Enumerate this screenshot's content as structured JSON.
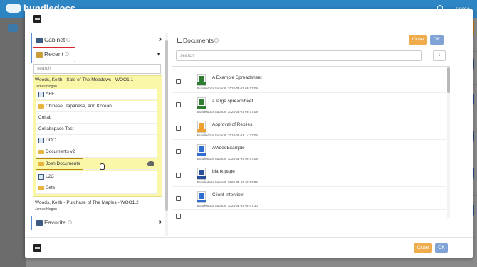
{
  "background": {
    "brand": "bundledocs",
    "user": "demo"
  },
  "modal": {
    "left": {
      "cabinet": {
        "label": "Cabinet"
      },
      "recent": {
        "label": "Recent"
      },
      "search_placeholder": "search",
      "group1": {
        "title": "Woods, Keith - Sale of The Meadows - WOO1.1",
        "subtitle": "James Hogan",
        "items": [
          {
            "label": "AFF",
            "icon": "binder-icon"
          },
          {
            "label": "Chinese, Japanese, and Korean",
            "icon": "folder-icon"
          },
          {
            "label": "Collab",
            "icon": "none"
          },
          {
            "label": "Collabspace Test",
            "icon": "none"
          },
          {
            "label": "DOC",
            "icon": "binder-icon"
          },
          {
            "label": "Documents v2",
            "icon": "folder-icon"
          },
          {
            "label": "Josh Documents",
            "icon": "folder-icon"
          },
          {
            "label": "L2C",
            "icon": "binder-icon"
          },
          {
            "label": "Sets",
            "icon": "folder-icon"
          }
        ]
      },
      "group2": {
        "title": "Woods, Keith - Purchase of The Maples - WOO1.2",
        "subtitle": "James Hogan"
      },
      "favorite": {
        "label": "Favorite"
      }
    },
    "right": {
      "title": "Documents",
      "close_label": "Close",
      "ok_label": "OK",
      "search_placeholder": "search",
      "more_label": "⋮",
      "documents": [
        {
          "name": "A Example Spreadsheet",
          "owner": "Bundledocs Support",
          "date": "2024-04-23 09:07:09",
          "type": "XLSX",
          "color": "#2e7d32"
        },
        {
          "name": "a large spreadsheet",
          "owner": "Bundledocs Support",
          "date": "2024-04-23 09:07:09",
          "type": "XLSX",
          "color": "#2e7d32"
        },
        {
          "name": "Approval of Replies",
          "owner": "Bundledocs Support",
          "date": "2018-01-23 14:23:05",
          "type": "EML",
          "color": "#f0a030"
        },
        {
          "name": "AVideoExample",
          "owner": "Bundledocs Support",
          "date": "2024-04-23 09:07:09",
          "type": "MP4",
          "color": "#2f6dd1"
        },
        {
          "name": "blank page",
          "owner": "Bundledocs Support",
          "date": "2024-04-23 09:07:09",
          "type": "DOC",
          "color": "#2a4f9a"
        },
        {
          "name": "Client Interview",
          "owner": "Bundledocs Support",
          "date": "2024-04-23 09:07:10",
          "type": "MP4",
          "color": "#2f6dd1"
        }
      ]
    },
    "footer": {
      "close_label": "Close",
      "ok_label": "OK"
    }
  }
}
